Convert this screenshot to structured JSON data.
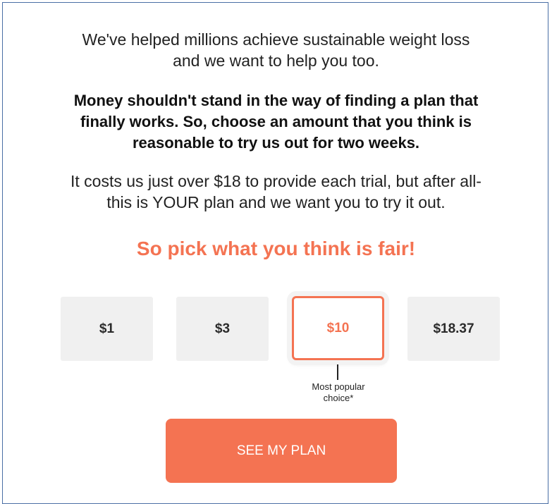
{
  "intro": {
    "line1": "We've helped millions achieve sustainable weight loss",
    "line2": "and we want to help you too."
  },
  "message": {
    "line1": "Money shouldn't stand in the way of finding a plan that",
    "line2": "finally works. So, choose an amount that you think is",
    "line3": "reasonable to try us out for two weeks."
  },
  "cost": {
    "line1": "It costs us just over $18 to provide each trial, but after all-",
    "line2": "this is YOUR plan and we want you to try it out."
  },
  "headline": "So pick what you think is fair!",
  "options": [
    {
      "label": "$1",
      "selected": false
    },
    {
      "label": "$3",
      "selected": false
    },
    {
      "label": "$10",
      "selected": true
    },
    {
      "label": "$18.37",
      "selected": false
    }
  ],
  "popular_note": {
    "line1": "Most popular",
    "line2": "choice*"
  },
  "cta": {
    "label": "SEE MY PLAN"
  },
  "colors": {
    "accent": "#f47352",
    "option_bg": "#f0f0f0",
    "text": "#222222",
    "frame_border": "#4a6fa5"
  }
}
